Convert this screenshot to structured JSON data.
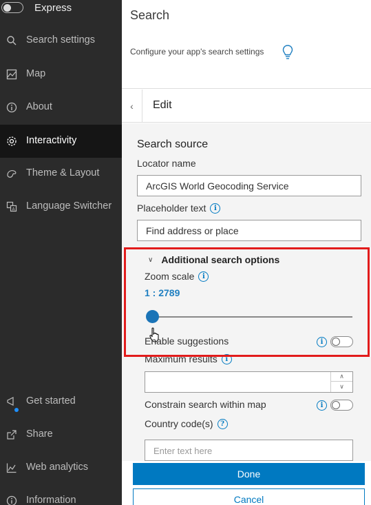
{
  "sidebar": {
    "express_label": "Express",
    "items": [
      {
        "label": "Search settings",
        "icon": "search-icon"
      },
      {
        "label": "Map",
        "icon": "map-icon"
      },
      {
        "label": "About",
        "icon": "info-icon"
      },
      {
        "label": "Interactivity",
        "icon": "gear-icon",
        "active": true
      },
      {
        "label": "Theme & Layout",
        "icon": "palette-icon"
      },
      {
        "label": "Language Switcher",
        "icon": "language-icon"
      }
    ],
    "bottom_items": [
      {
        "label": "Get started",
        "icon": "megaphone-icon"
      },
      {
        "label": "Share",
        "icon": "share-icon"
      },
      {
        "label": "Web analytics",
        "icon": "analytics-icon"
      },
      {
        "label": "Information",
        "icon": "info-icon"
      }
    ]
  },
  "header": {
    "title": "Search",
    "subtitle": "Configure your app's search settings"
  },
  "edit": {
    "title": "Edit"
  },
  "panel": {
    "section_title": "Search source",
    "locator_label": "Locator name",
    "locator_value": "ArcGIS World Geocoding Service",
    "placeholder_label": "Placeholder text",
    "placeholder_value": "Find address or place",
    "additional_title": "Additional search options",
    "zoom_label": "Zoom scale",
    "zoom_value": "1 : 2789",
    "zoom_slider_level": 0.0,
    "suggestions_label": "Enable suggestions",
    "max_results_label": "Maximum results",
    "constrain_label": "Constrain search within map",
    "country_label": "Country code(s)",
    "country_placeholder": "Enter text here"
  },
  "footer": {
    "done_label": "Done",
    "cancel_label": "Cancel"
  },
  "colors": {
    "accent": "#0079c1",
    "highlight_box": "#e21b1b",
    "sidebar_bg": "#2b2b2b"
  }
}
